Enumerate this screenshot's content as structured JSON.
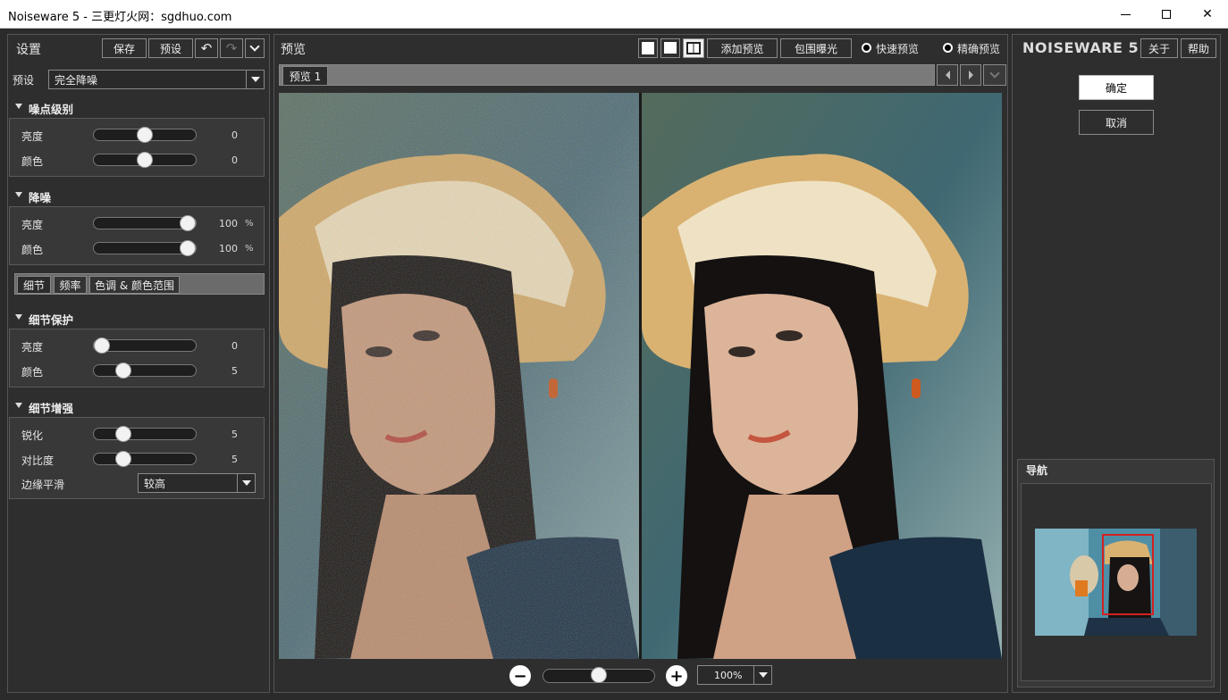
{
  "window": {
    "title": "Noiseware 5 - 三更灯火网：sgdhuo.com"
  },
  "settings": {
    "title": "设置",
    "save": "保存",
    "preset_btn": "预设",
    "preset_label": "预设",
    "preset_value": "完全降噪",
    "noise_level": {
      "title": "噪点级别",
      "rows": [
        {
          "label": "亮度",
          "value": "0",
          "level": 0.5
        },
        {
          "label": "颜色",
          "value": "0",
          "level": 0.5
        }
      ]
    },
    "noise_reduction": {
      "title": "降噪",
      "rows": [
        {
          "label": "亮度",
          "value": "100",
          "unit": "%",
          "level": 1.0
        },
        {
          "label": "颜色",
          "value": "100",
          "unit": "%",
          "level": 1.0
        }
      ]
    },
    "tabs": [
      "细节",
      "频率",
      "色调 & 颜色范围"
    ],
    "detail_protect": {
      "title": "细节保护",
      "rows": [
        {
          "label": "亮度",
          "value": "0",
          "level": 0.0
        },
        {
          "label": "颜色",
          "value": "5",
          "level": 0.25
        }
      ]
    },
    "detail_enhance": {
      "title": "细节增强",
      "rows": [
        {
          "label": "锐化",
          "value": "5",
          "level": 0.25
        },
        {
          "label": "对比度",
          "value": "5",
          "level": 0.25
        }
      ],
      "edge_label": "边缘平滑",
      "edge_value": "较高"
    }
  },
  "preview": {
    "title": "预览",
    "add_preview": "添加预览",
    "clip_exposure": "包围曝光",
    "fast_preview": "快速预览",
    "accurate_preview": "精确预览",
    "tab": "预览 1",
    "zoom": "100%",
    "zoom_level": 0.5
  },
  "right": {
    "logo": "NOISEWARE 5",
    "about": "关于",
    "help": "帮助",
    "ok": "确定",
    "cancel": "取消",
    "navigator": "导航"
  },
  "colors": {
    "accent": "#d42020"
  }
}
